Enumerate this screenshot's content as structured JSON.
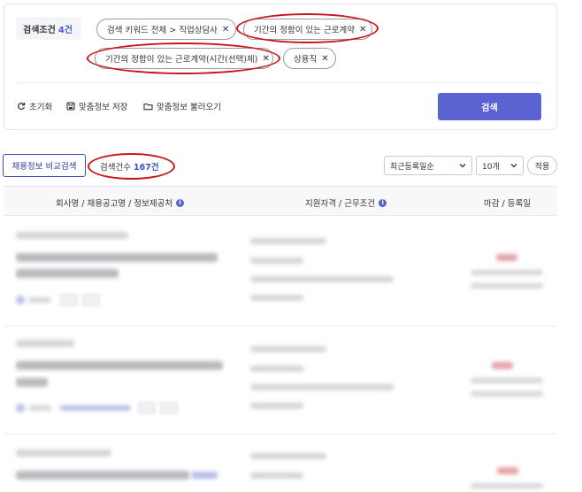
{
  "filters": {
    "label": "검색조건",
    "count": "4건",
    "chips": [
      {
        "text": "검색 키워드 전체 > 직업상담사"
      },
      {
        "text": "기간의 정함이 있는 근로계약"
      },
      {
        "text": "기간의 정함이 있는 근로계약(시간(선택)제)"
      },
      {
        "text": "상용직"
      }
    ],
    "remove_glyph": "✕",
    "reset_label": "초기화",
    "save_label": "맞춤정보 저장",
    "load_label": "맞춤정보 불러오기",
    "search_label": "검색"
  },
  "results": {
    "compare_label": "채용정보 비교검색",
    "count_prefix": "검색건수",
    "count_value": "167건",
    "sort_selected": "최근등록일순",
    "page_size_selected": "10개",
    "apply_label": "적용"
  },
  "table": {
    "columns": [
      {
        "label": "회사명 / 채용공고명 / 정보제공처"
      },
      {
        "label": "지원자격 / 근무조건"
      },
      {
        "label": "마감 / 등록일"
      }
    ],
    "info_glyph": "i"
  },
  "icons": {
    "reset": "refresh-icon",
    "save": "save-icon",
    "load": "folder-icon",
    "dropdown": "chevron-down-icon"
  },
  "colors": {
    "accent": "#5b63d3",
    "count_blue": "#3d4fc5",
    "highlight_red": "#c8161d"
  }
}
